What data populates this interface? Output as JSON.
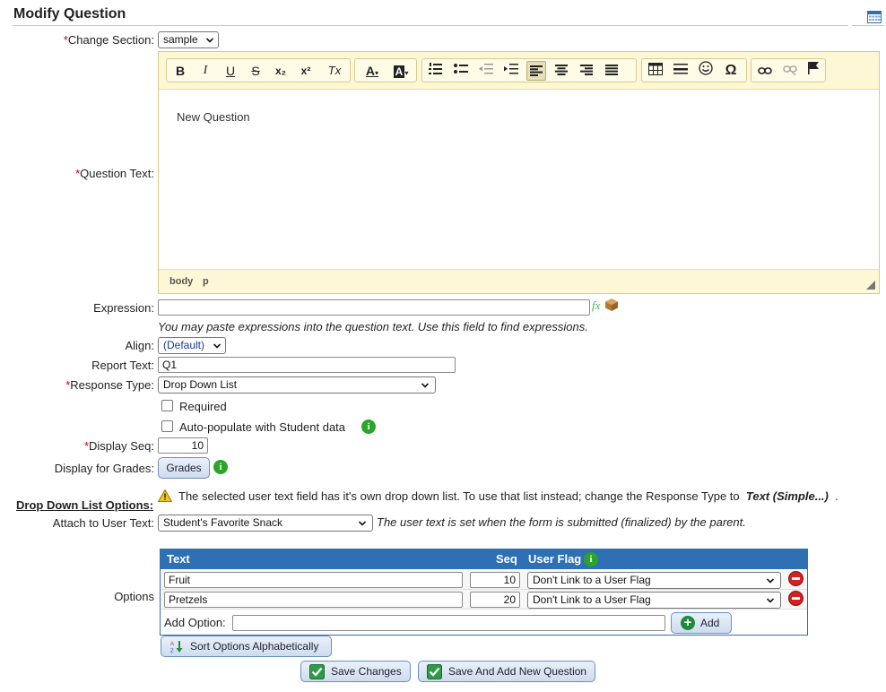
{
  "page": {
    "title": "Modify Question"
  },
  "change_section": {
    "label": "Change Section:",
    "value": "sample"
  },
  "question_text": {
    "label": "Question Text:",
    "content": "New Question",
    "path": [
      "body",
      "p"
    ]
  },
  "toolbar": {
    "bold": "B",
    "italic": "I",
    "underline": "U",
    "strike": "S",
    "subscript": "x₂",
    "superscript": "x²",
    "clear_format": "Tx",
    "text_color": "A",
    "bg_color": "A",
    "omega": "Ω"
  },
  "expression": {
    "label": "Expression:",
    "value": "",
    "note": "You may paste expressions into the question text. Use this field to find expressions."
  },
  "align": {
    "label": "Align:",
    "value": "(Default)"
  },
  "report_text": {
    "label": "Report Text:",
    "value": "Q1"
  },
  "response_type": {
    "label": "Response Type:",
    "value": "Drop Down List"
  },
  "required": {
    "label": "Required",
    "checked": false
  },
  "autopopulate": {
    "label": "Auto-populate with Student data",
    "checked": false
  },
  "display_seq": {
    "label": "Display Seq:",
    "value": "10"
  },
  "display_grades": {
    "label": "Display for Grades:",
    "button": "Grades"
  },
  "dropdown_options": {
    "heading": "Drop Down List Options:",
    "warning": "The selected user text field has it's own drop down list. To use that list instead; change the Response Type to",
    "warning_emph": "Text (Simple...)",
    "warning_end": "."
  },
  "attach_user_text": {
    "label": "Attach to User Text:",
    "value": "Student's Favorite Snack",
    "note": "The user text is set when the form is submitted (finalized) by the parent."
  },
  "options": {
    "label": "Options",
    "headers": {
      "text": "Text",
      "seq": "Seq",
      "flag": "User Flag"
    },
    "rows": [
      {
        "text": "Fruit",
        "seq": "10",
        "flag": "Don't Link to a User Flag"
      },
      {
        "text": "Pretzels",
        "seq": "20",
        "flag": "Don't Link to a User Flag"
      }
    ],
    "add_label": "Add Option:",
    "add_value": "",
    "add_button": "Add",
    "sort_button": "Sort Options Alphabetically"
  },
  "actions": {
    "save": "Save Changes",
    "save_add": "Save And Add New Question"
  },
  "colors": {
    "accent": "#2f6fb3",
    "required": "#cc0000",
    "info": "#2aa52a",
    "remove": "#d42020"
  }
}
